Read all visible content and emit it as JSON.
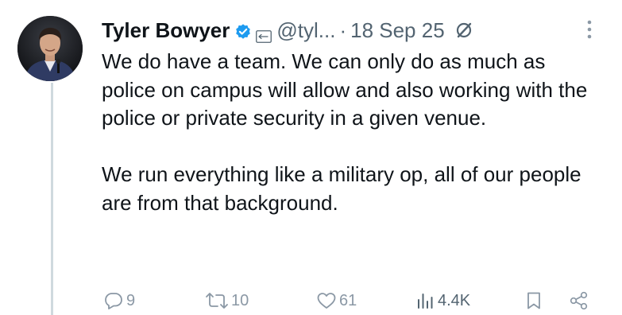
{
  "author": {
    "name": "Tyler Bowyer",
    "handle": "@tyl...",
    "date": "18 Sep 25",
    "separator": "·"
  },
  "icons": {
    "verified": "verified-badge-icon",
    "affiliate": "affiliate-badge-icon",
    "grok": "grok-icon",
    "more": "more-options-icon"
  },
  "body": {
    "paragraph_1": "We do have a team. We can only do as much as police on campus will allow and also working with the police or private security in a given venue.",
    "paragraph_2": "We run everything like a military op, all of our people are from that background."
  },
  "actions": {
    "replies": "9",
    "reposts": "10",
    "likes": "61",
    "views": "4.4K"
  },
  "colors": {
    "text": "#0f1419",
    "secondary": "#536471",
    "verified": "#1d9bf0",
    "action_icon": "#8b98a5",
    "thread_line": "#cfd9de"
  }
}
